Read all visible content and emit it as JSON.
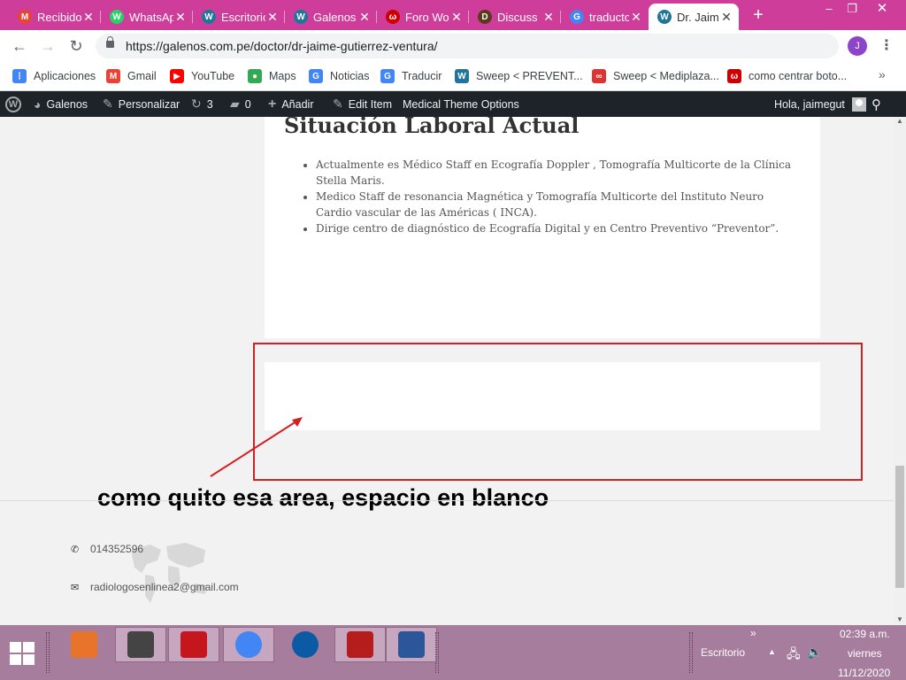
{
  "browser": {
    "tabs": [
      {
        "title": "Recibidos",
        "icon": "gmail-icon",
        "color": "#ea4335",
        "glyph": "M"
      },
      {
        "title": "WhatsApp",
        "icon": "whatsapp-icon",
        "color": "#25d366",
        "glyph": "W"
      },
      {
        "title": "Escritorio",
        "icon": "wordpress-icon",
        "color": "#21759b",
        "glyph": "W"
      },
      {
        "title": "Galenos",
        "icon": "wordpress-icon",
        "color": "#21759b",
        "glyph": "W"
      },
      {
        "title": "Foro WordPress",
        "icon": "foro-icon",
        "color": "#cc0000",
        "glyph": "ω"
      },
      {
        "title": "Discuss",
        "icon": "discuss-icon",
        "color": "#5a3a1a",
        "glyph": "D"
      },
      {
        "title": "traductor",
        "icon": "google-icon",
        "color": "#4285f4",
        "glyph": "G"
      },
      {
        "title": "Dr. Jaime",
        "icon": "wordpress-icon",
        "color": "#21759b",
        "glyph": "W"
      }
    ],
    "active_tab": 7,
    "url": "https://galenos.com.pe/doctor/dr-jaime-gutierrez-ventura/",
    "profile_initial": "J",
    "bookmarks": [
      {
        "label": "Aplicaciones",
        "icon": "apps-grid-icon",
        "color": "#4285f4",
        "glyph": "⋮"
      },
      {
        "label": "Gmail",
        "icon": "gmail-icon",
        "color": "#ea4335",
        "glyph": "M"
      },
      {
        "label": "YouTube",
        "icon": "youtube-icon",
        "color": "#ff0000",
        "glyph": "▶"
      },
      {
        "label": "Maps",
        "icon": "maps-pin-icon",
        "color": "#34a853",
        "glyph": "●"
      },
      {
        "label": "Noticias",
        "icon": "news-icon",
        "color": "#4285f4",
        "glyph": "G"
      },
      {
        "label": "Traducir",
        "icon": "translate-icon",
        "color": "#4285f4",
        "glyph": "G"
      },
      {
        "label": "Sweep < PREVENT...",
        "icon": "wordpress-icon",
        "color": "#21759b",
        "glyph": "W"
      },
      {
        "label": "Sweep < Mediplaza...",
        "icon": "link-icon",
        "color": "#d33",
        "glyph": "∞"
      },
      {
        "label": "como centrar boto...",
        "icon": "foro-icon",
        "color": "#cc0000",
        "glyph": "ω"
      }
    ]
  },
  "wp_admin_bar": {
    "site_name": "Galenos",
    "customize": "Personalizar",
    "updates_count": "3",
    "comments_count": "0",
    "add_new": "Añadir",
    "edit_item": "Edit Item",
    "theme_options": "Medical Theme Options",
    "greeting": "Hola, jaimegut"
  },
  "content": {
    "section_title": "Situación Laboral Actual",
    "bullets": [
      "Actualmente es Médico Staff en Ecografía Doppler , Tomografía Multicorte de la Clínica Stella Maris.",
      "Medico Staff de resonancia Magnética y Tomografía Multicorte del Instituto Neuro Cardio vascular de las Américas ( INCA).",
      "Dirige centro de diagnóstico de Ecografía Digital y en Centro Preventivo “Preventor”."
    ],
    "annotation": "como quito esa area, espacio en blanco",
    "annotation_color": "#d42020"
  },
  "footer": {
    "phone": "014352596",
    "email": "radiologosenlinea2@gmail.com"
  },
  "taskbar": {
    "apps": [
      {
        "name": "media-player-icon",
        "color": "#e8732a",
        "pressed": false
      },
      {
        "name": "sweep-app-icon",
        "color": "#444444",
        "pressed": true
      },
      {
        "name": "acrobat-icon",
        "color": "#c4161c",
        "pressed": true
      },
      {
        "name": "chrome-icon",
        "color": "#4285f4",
        "pressed": true
      },
      {
        "name": "edge-icon",
        "color": "#0c59a4",
        "pressed": false
      },
      {
        "name": "filezilla-icon",
        "color": "#b51d1d",
        "pressed": true
      },
      {
        "name": "word-icon",
        "color": "#2b579a",
        "pressed": true
      }
    ],
    "desktop_label": "Escritorio",
    "time": "02:39 a.m.",
    "day": "viernes",
    "date": "11/12/2020"
  }
}
